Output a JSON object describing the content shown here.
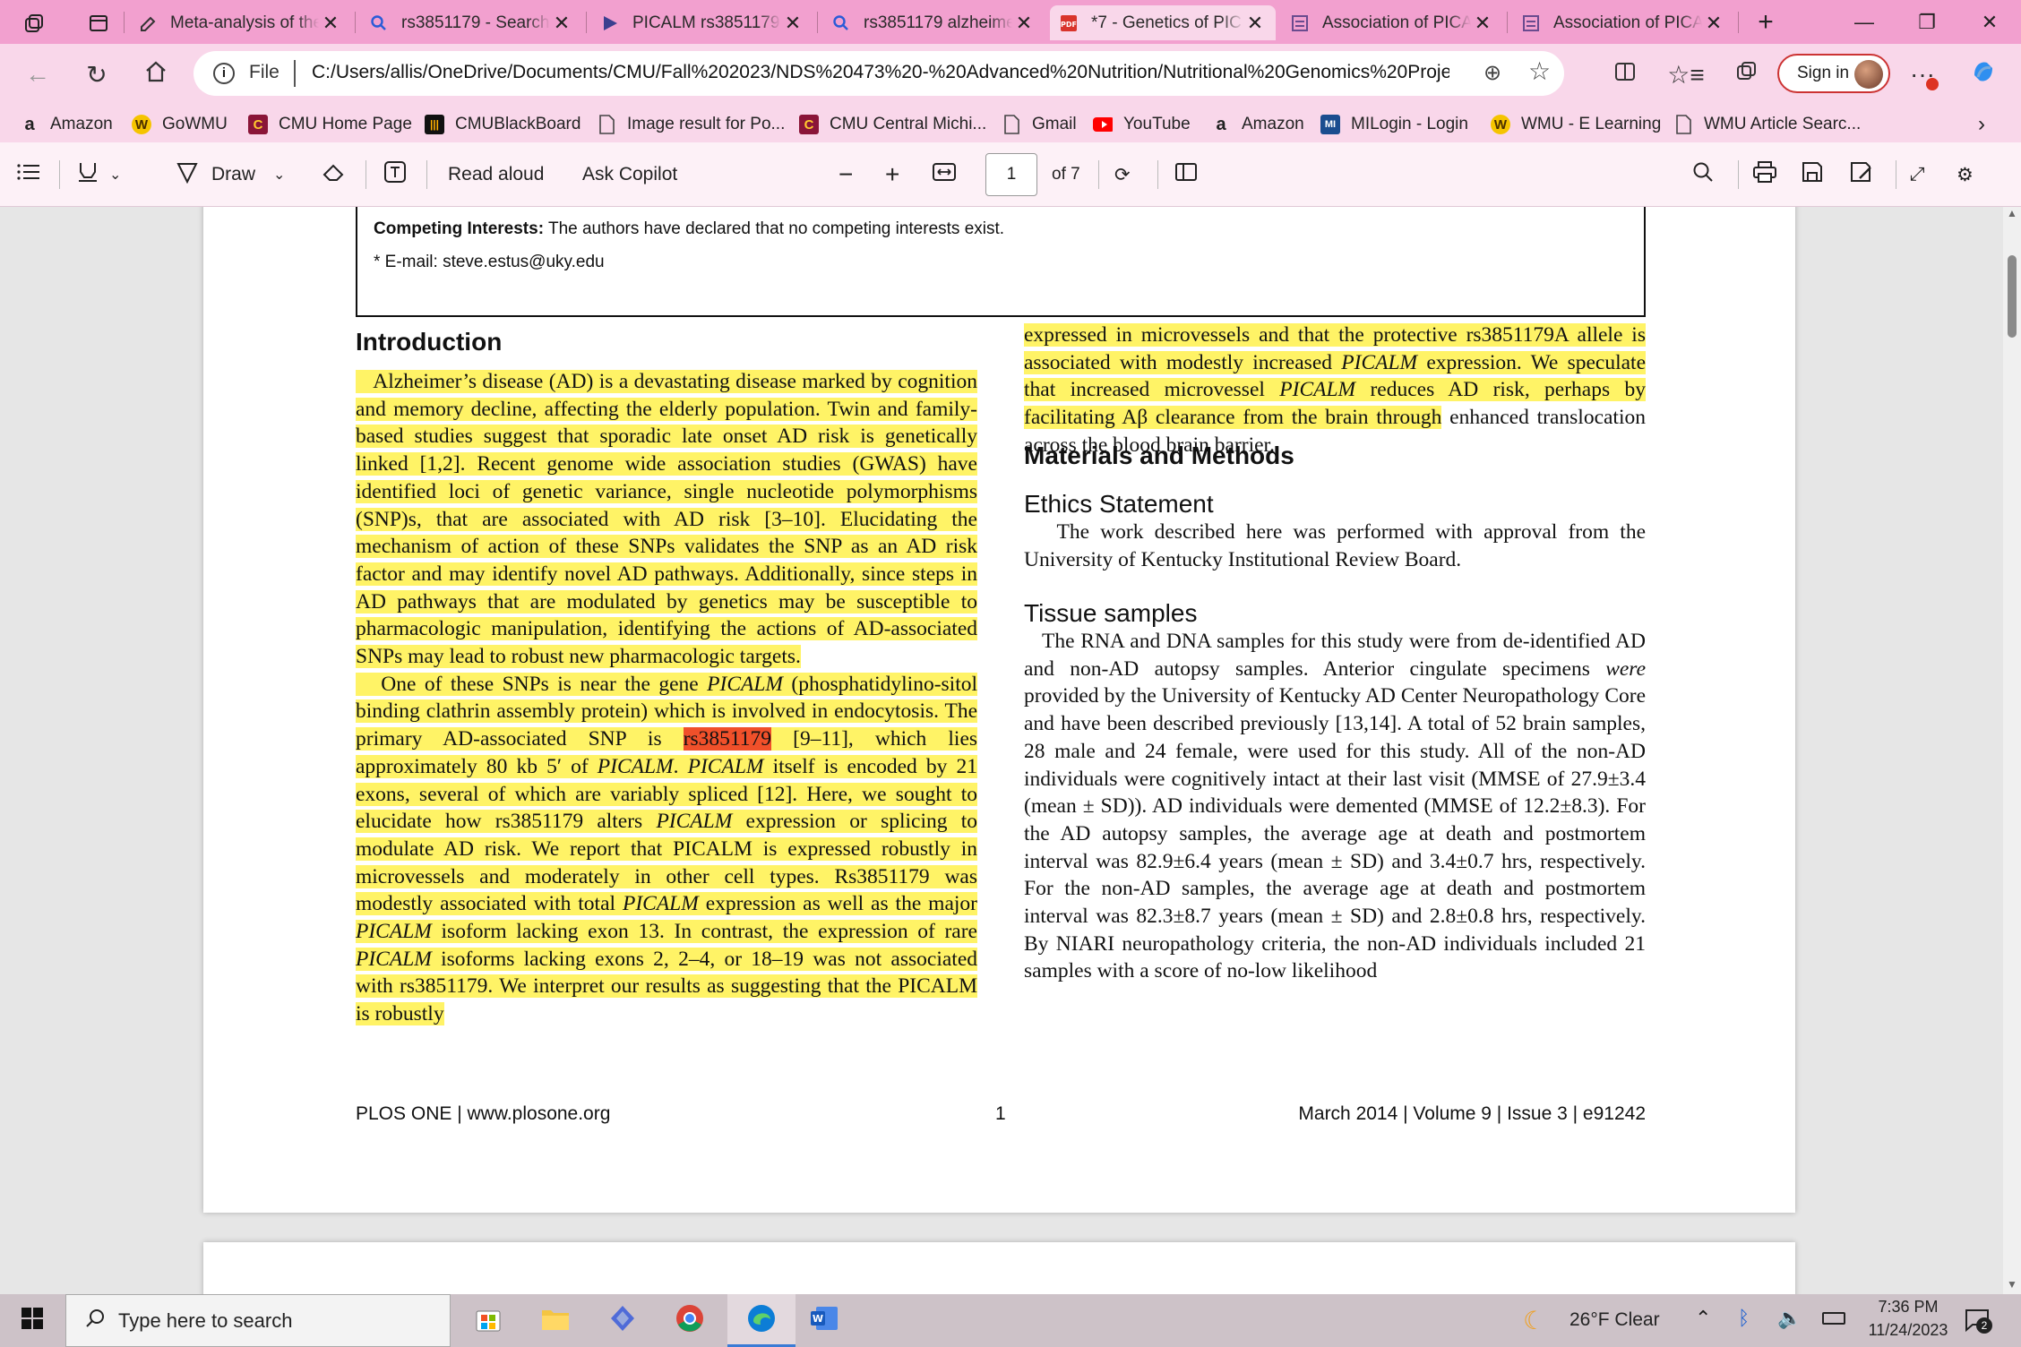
{
  "browser": {
    "tabs": [
      {
        "title": "",
        "icon": "workspaces-icon"
      },
      {
        "title": "",
        "icon": "tab-actions-icon"
      },
      {
        "title": "Meta-analysis of the",
        "icon": "copilot-chat-icon"
      },
      {
        "title": "rs3851179 - Search",
        "icon": "search-icon"
      },
      {
        "title": "PICALM rs3851179",
        "icon": "media-icon"
      },
      {
        "title": "rs3851179 alzheime",
        "icon": "search-icon"
      },
      {
        "title": "*7 - Genetics of PIC",
        "icon": "pdf-icon"
      },
      {
        "title": "Association of PICAI",
        "icon": "journal-icon"
      },
      {
        "title": "Association of PICA",
        "icon": "journal-icon"
      }
    ],
    "address": {
      "prefix": "File",
      "url": "C:/Users/allis/OneDrive/Documents/CMU/Fall%202023/NDS%20473%20-%20Advanced%20Nutrition/Nutritional%20Genomics%20Project..."
    },
    "sign_in": "Sign in",
    "favorites": [
      {
        "label": "Amazon",
        "icon": "a",
        "color": "#111111"
      },
      {
        "label": "GoWMU",
        "icon": "W",
        "color": "#8a5a00"
      },
      {
        "label": "CMU Home Page",
        "icon": "C",
        "color": "#8a1538"
      },
      {
        "label": "CMUBlackBoard",
        "icon": "|||",
        "color": "#ffb000"
      },
      {
        "label": "Image result for Po...",
        "icon": "doc",
        "color": "#444444"
      },
      {
        "label": "CMU Central Michi...",
        "icon": "C",
        "color": "#8a1538"
      },
      {
        "label": "Gmail",
        "icon": "doc",
        "color": "#444444"
      },
      {
        "label": "YouTube",
        "icon": "play",
        "color": "#ff0000"
      },
      {
        "label": "Amazon",
        "icon": "a",
        "color": "#111111"
      },
      {
        "label": "MILogin - Login",
        "icon": "mi",
        "color": "#1a4d8f"
      },
      {
        "label": "WMU - E Learning",
        "icon": "W",
        "color": "#8a5a00"
      },
      {
        "label": "WMU Article Searc...",
        "icon": "doc",
        "color": "#444444"
      }
    ]
  },
  "pdf_toolbar": {
    "draw": "Draw",
    "read_aloud": "Read aloud",
    "ask_copilot": "Ask Copilot",
    "page_current": "1",
    "page_total": "of 7"
  },
  "document": {
    "competing_label": "Competing Interests:",
    "competing_text": " The authors have declared that no competing interests exist.",
    "email_line": "* E-mail: steve.estus@uky.edu",
    "intro_heading": "Introduction",
    "methods_heading": "Materials and Methods",
    "ethics_heading": "Ethics Statement",
    "tissue_heading": "Tissue samples",
    "footer_left": "PLOS ONE | www.plosone.org",
    "footer_center": "1",
    "footer_right": "March 2014 | Volume 9 | Issue 3 | e91242"
  },
  "taskbar": {
    "search_placeholder": "Type here to search",
    "weather": "26°F Clear",
    "time": "7:36 PM",
    "date": "11/24/2023",
    "notifications": "2"
  }
}
